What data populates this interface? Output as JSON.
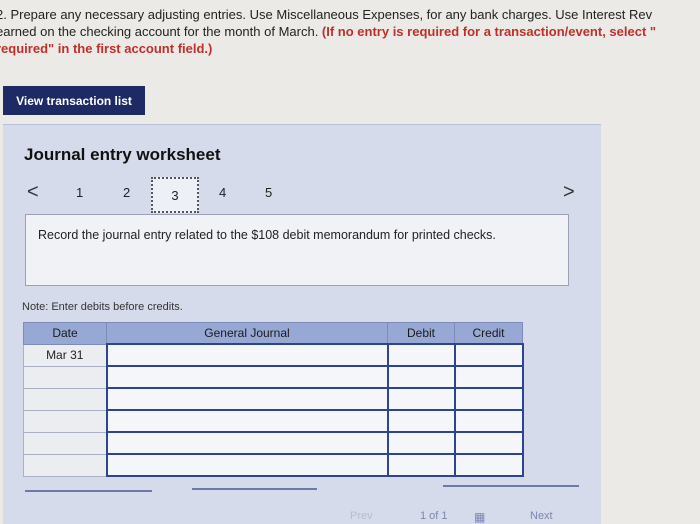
{
  "instructions": {
    "line1": "2. Prepare any necessary adjusting entries. Use Miscellaneous Expenses, for any bank charges. Use Interest Rev",
    "line2_normal": "earned on the checking account for the month of March. ",
    "line2_red": "(If no entry is required for a transaction/event, select \"",
    "line3_red": "required\" in the first account field.)"
  },
  "view_button": {
    "label": "View transaction list"
  },
  "worksheet": {
    "title": "Journal entry worksheet",
    "nav": {
      "prev": "<",
      "next": ">",
      "pages": [
        "1",
        "2",
        "3",
        "4",
        "5"
      ],
      "active_page": "3"
    },
    "prompt": "Record the journal entry related to the $108 debit memorandum for printed checks.",
    "note": "Note: Enter debits before credits.",
    "table": {
      "headers": {
        "date": "Date",
        "account": "General Journal",
        "debit": "Debit",
        "credit": "Credit"
      },
      "rows": [
        {
          "date": "Mar 31"
        },
        {
          "date": ""
        },
        {
          "date": ""
        },
        {
          "date": ""
        },
        {
          "date": ""
        },
        {
          "date": ""
        }
      ]
    }
  },
  "footer": {
    "prev_label": "Prev",
    "page_indicator": "1 of 1",
    "next_label": "Next"
  },
  "colors": {
    "button_bg": "#1d2a64",
    "worksheet_bg": "#d6dbeb",
    "table_header_bg": "#98a8d4",
    "input_border": "#2d4590",
    "required_text": "#c0302b"
  }
}
